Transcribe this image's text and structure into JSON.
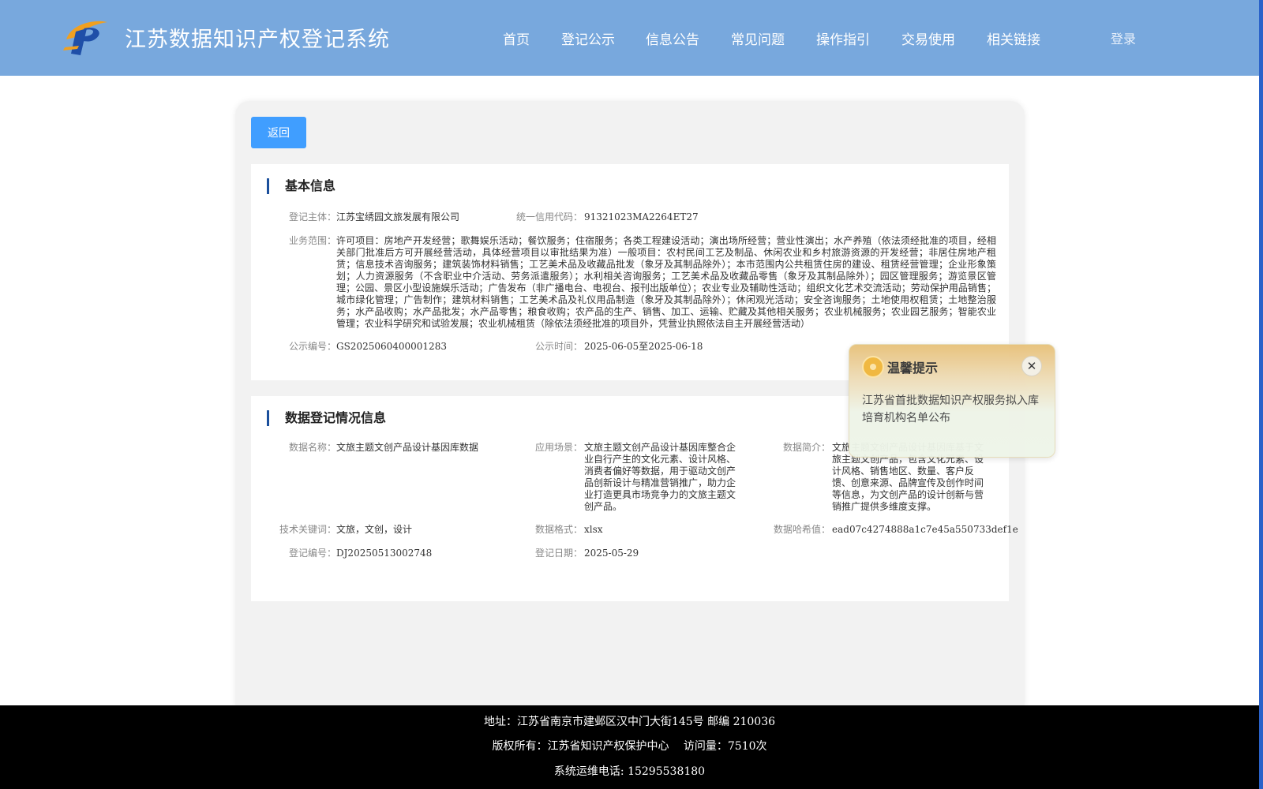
{
  "header": {
    "site_title": "江苏数据知识产权登记系统",
    "nav": [
      "首页",
      "登记公示",
      "信息公告",
      "常见问题",
      "操作指引",
      "交易使用",
      "相关链接"
    ],
    "login": "登录"
  },
  "back_label": "返回",
  "basic_info": {
    "title": "基本信息",
    "subject_label": "登记主体：",
    "subject_value": "江苏宝绣园文旅发展有限公司",
    "credit_label": "统一信用代码：",
    "credit_value": "91321023MA2264ET27",
    "scope_label": "业务范围：",
    "scope_value": "许可项目：房地产开发经营；歌舞娱乐活动；餐饮服务；住宿服务；各类工程建设活动；演出场所经营；营业性演出；水产养殖（依法须经批准的项目，经相关部门批准后方可开展经营活动，具体经营项目以审批结果为准）一般项目：农村民间工艺及制品、休闲农业和乡村旅游资源的开发经营；非居住房地产租赁；信息技术咨询服务；建筑装饰材料销售；工艺美术品及收藏品批发（象牙及其制品除外）；本市范围内公共租赁住房的建设、租赁经营管理；企业形象策划；人力资源服务（不含职业中介活动、劳务派遣服务）；水利相关咨询服务；工艺美术品及收藏品零售（象牙及其制品除外）；园区管理服务；游览景区管理；公园、景区小型设施娱乐活动；广告发布（非广播电台、电视台、报刊出版单位）；农业专业及辅助性活动；组织文化艺术交流活动；劳动保护用品销售；城市绿化管理；广告制作；建筑材料销售；工艺美术品及礼仪用品制造（象牙及其制品除外）；休闲观光活动；安全咨询服务；土地使用权租赁；土地整治服务；水产品收购；水产品批发；水产品零售；粮食收购；农产品的生产、销售、加工、运输、贮藏及其他相关服务；农业机械服务；农业园艺服务；智能农业管理；农业科学研究和试验发展；农业机械租赁（除依法须经批准的项目外，凭营业执照依法自主开展经营活动）",
    "pub_no_label": "公示编号：",
    "pub_no_value": "GS2025060400001283",
    "pub_time_label": "公示时间：",
    "pub_time_value": "2025-06-05至2025-06-18"
  },
  "data_info": {
    "title": "数据登记情况信息",
    "name_label": "数据名称：",
    "name_value": "文旅主题文创产品设计基因库数据",
    "scene_label": "应用场景：",
    "scene_value": "文旅主题文创产品设计基因库整合企业自行产生的文化元素、设计风格、消费者偏好等数据，用于驱动文创产品创新设计与精准营销推广，助力企业打造更具市场竞争力的文旅主题文创产品。",
    "intro_label": "数据简介：",
    "intro_value": "文旅主题文创产品设计基因库基于文旅主题文创产品，包含文化元素、设计风格、销售地区、数量、客户反馈、创意来源、品牌宣传及创作时间等信息，为文创产品的设计创新与营销推广提供多维度支撑。",
    "keywords_label": "技术关键词：",
    "keywords_value": "文旅，文创，设计",
    "format_label": "数据格式：",
    "format_value": "xlsx",
    "hash_label": "数据哈希值：",
    "hash_value": "ead07c4274888a1c7e45a550733def1e",
    "reg_no_label": "登记编号：",
    "reg_no_value": "DJ20250513002748",
    "reg_date_label": "登记日期：",
    "reg_date_value": "2025-05-29"
  },
  "popup": {
    "title": "温馨提示",
    "close": "✕",
    "text": "江苏省首批数据知识产权服务拟入库培育机构名单公布"
  },
  "footer": {
    "address": "地址：江苏省南京市建邺区汉中门大街145号 邮编 210036",
    "copyright": "版权所有：江苏省知识产权保护中心　  访问量：7510次",
    "phone": "系统运维电话: 15295538180"
  }
}
